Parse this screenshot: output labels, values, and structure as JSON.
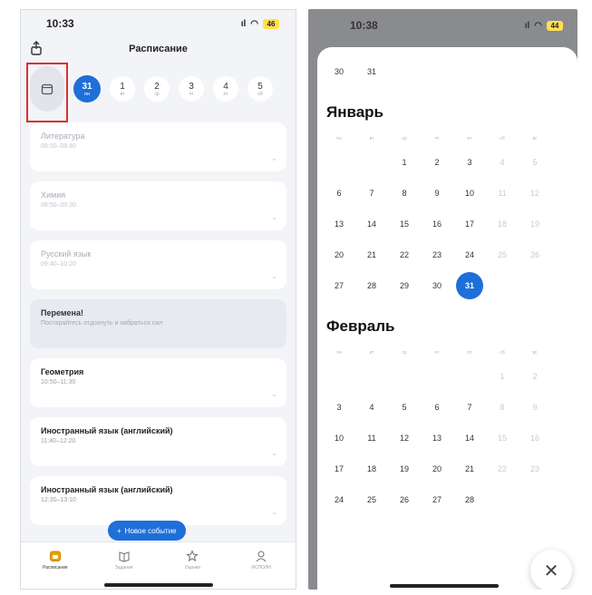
{
  "left": {
    "status": {
      "time": "10:33",
      "signal": "ıl",
      "wifi": "◠",
      "battery": "46"
    },
    "title": "Расписание",
    "days": [
      {
        "num": "31",
        "dow": "пн"
      },
      {
        "num": "1",
        "dow": "вт"
      },
      {
        "num": "2",
        "dow": "ср"
      },
      {
        "num": "3",
        "dow": "чт"
      },
      {
        "num": "4",
        "dow": "пт"
      },
      {
        "num": "5",
        "dow": "сб"
      }
    ],
    "lessons": [
      {
        "name": "Литература",
        "time": "08:00–08:40"
      },
      {
        "name": "Химия",
        "time": "08:50–09:30"
      },
      {
        "name": "Русский язык",
        "time": "09:40–10:20"
      },
      {
        "name": "Перемена!",
        "time": "Постарайтесь отдохнуть и набраться сил"
      },
      {
        "name": "Геометрия",
        "time": "10:50–11:30"
      },
      {
        "name": "Иностранный язык (английский)",
        "time": "11:40–12:20"
      },
      {
        "name": "Иностранный язык (английский)",
        "time": "12:30–13:10"
      }
    ],
    "new_event": "Новое событие",
    "tabs": [
      {
        "label": "Расписание"
      },
      {
        "label": "Задания"
      },
      {
        "label": "Оценки"
      },
      {
        "label": "ИСПОЛИ"
      }
    ]
  },
  "right": {
    "status": {
      "time": "10:38",
      "signal": "ıl",
      "wifi": "◠",
      "battery": "44"
    },
    "prev_row": [
      "30",
      "31"
    ],
    "weekdays": [
      "пн",
      "вт",
      "ср",
      "чт",
      "пт",
      "сб",
      "вс"
    ],
    "january": {
      "title": "Январь",
      "row1": [
        "",
        "",
        "1",
        "2",
        "3",
        "4",
        "5"
      ],
      "row2": [
        "6",
        "7",
        "8",
        "9",
        "10",
        "11",
        "12"
      ],
      "row3": [
        "13",
        "14",
        "15",
        "16",
        "17",
        "18",
        "19"
      ],
      "row4": [
        "20",
        "21",
        "22",
        "23",
        "24",
        "25",
        "26"
      ],
      "row5": [
        "27",
        "28",
        "29",
        "30",
        "31",
        "",
        ""
      ]
    },
    "february": {
      "title": "Февраль",
      "row1": [
        "",
        "",
        "",
        "",
        "",
        "1",
        "2"
      ],
      "row2": [
        "3",
        "4",
        "5",
        "6",
        "7",
        "8",
        "9"
      ],
      "row3": [
        "10",
        "11",
        "12",
        "13",
        "14",
        "15",
        "16"
      ],
      "row4": [
        "17",
        "18",
        "19",
        "20",
        "21",
        "22",
        "23"
      ],
      "row5": [
        "24",
        "25",
        "26",
        "27",
        "28",
        "",
        ""
      ]
    },
    "close": "✕"
  }
}
